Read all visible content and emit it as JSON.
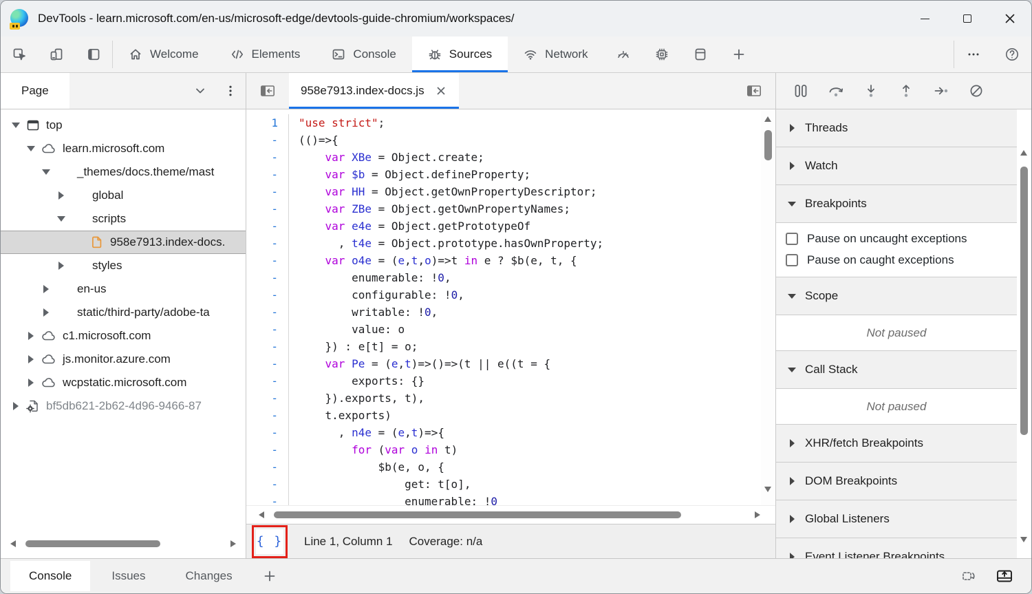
{
  "window": {
    "title": "DevTools - learn.microsoft.com/en-us/microsoft-edge/devtools-guide-chromium/workspaces/",
    "controls": [
      {
        "name": "minimize"
      },
      {
        "name": "maximize"
      },
      {
        "name": "close"
      }
    ]
  },
  "toolbar": {
    "tools": [
      {
        "icon": "inspect"
      },
      {
        "icon": "device-emulation"
      },
      {
        "icon": "focus-mode"
      }
    ],
    "tabs": [
      {
        "label": "Welcome",
        "icon": "home",
        "active": false
      },
      {
        "label": "Elements",
        "icon": "elements",
        "active": false
      },
      {
        "label": "Console",
        "icon": "console",
        "active": false
      },
      {
        "label": "Sources",
        "icon": "sources-bug",
        "active": true
      },
      {
        "label": "Network",
        "icon": "network",
        "active": false
      }
    ],
    "icon_tabs": [
      {
        "icon": "performance"
      },
      {
        "icon": "memory"
      },
      {
        "icon": "application"
      },
      {
        "icon": "add-tab"
      }
    ],
    "right_buttons": [
      {
        "icon": "more-options"
      },
      {
        "icon": "help"
      }
    ]
  },
  "sidebar": {
    "header": {
      "title": "Page",
      "icons": [
        "chevron-down",
        "kebab-menu"
      ]
    },
    "tree": [
      {
        "label": "top",
        "icon": "frame",
        "arrow": "down",
        "indent": 0
      },
      {
        "label": "learn.microsoft.com",
        "icon": "cloud",
        "arrow": "down",
        "indent": 1
      },
      {
        "label": "_themes/docs.theme/mast",
        "icon": "folder",
        "arrow": "down",
        "indent": 2
      },
      {
        "label": "global",
        "icon": "folder",
        "arrow": "right",
        "indent": 3
      },
      {
        "label": "scripts",
        "icon": "folder",
        "arrow": "down",
        "indent": 3
      },
      {
        "label": "958e7913.index-docs.",
        "icon": "file",
        "arrow": null,
        "indent": 4,
        "selected": true
      },
      {
        "label": "styles",
        "icon": "folder",
        "arrow": "right",
        "indent": 3
      },
      {
        "label": "en-us",
        "icon": "folder",
        "arrow": "right",
        "indent": 2
      },
      {
        "label": "static/third-party/adobe-ta",
        "icon": "folder",
        "arrow": "right",
        "indent": 2
      },
      {
        "label": "c1.microsoft.com",
        "icon": "cloud",
        "arrow": "right",
        "indent": 1
      },
      {
        "label": "js.monitor.azure.com",
        "icon": "cloud",
        "arrow": "right",
        "indent": 1
      },
      {
        "label": "wcpstatic.microsoft.com",
        "icon": "cloud",
        "arrow": "right",
        "indent": 1
      },
      {
        "label": "bf5db621-2b62-4d96-9466-87",
        "icon": "worker",
        "arrow": "right",
        "indent": 0,
        "muted": true
      }
    ]
  },
  "editor": {
    "tab": {
      "name": "958e7913.index-docs.js",
      "close_icon": "close"
    },
    "code_lines": [
      {
        "g": "1",
        "s": [
          [
            "\"use strict\"",
            "s"
          ],
          [
            ";",
            "d"
          ]
        ]
      },
      {
        "g": "-",
        "s": [
          [
            "(()=>{",
            "d"
          ]
        ]
      },
      {
        "g": "-",
        "s": [
          [
            "    ",
            "d"
          ],
          [
            "var",
            "k"
          ],
          [
            " ",
            "d"
          ],
          [
            "XBe",
            "v"
          ],
          [
            " = Object.create;",
            "d"
          ]
        ]
      },
      {
        "g": "-",
        "s": [
          [
            "    ",
            "d"
          ],
          [
            "var",
            "k"
          ],
          [
            " ",
            "d"
          ],
          [
            "$b",
            "v"
          ],
          [
            " = Object.defineProperty;",
            "d"
          ]
        ]
      },
      {
        "g": "-",
        "s": [
          [
            "    ",
            "d"
          ],
          [
            "var",
            "k"
          ],
          [
            " ",
            "d"
          ],
          [
            "HH",
            "v"
          ],
          [
            " = Object.getOwnPropertyDescriptor;",
            "d"
          ]
        ]
      },
      {
        "g": "-",
        "s": [
          [
            "    ",
            "d"
          ],
          [
            "var",
            "k"
          ],
          [
            " ",
            "d"
          ],
          [
            "ZBe",
            "v"
          ],
          [
            " = Object.getOwnPropertyNames;",
            "d"
          ]
        ]
      },
      {
        "g": "-",
        "s": [
          [
            "    ",
            "d"
          ],
          [
            "var",
            "k"
          ],
          [
            " ",
            "d"
          ],
          [
            "e4e",
            "v"
          ],
          [
            " = Object.getPrototypeOf",
            "d"
          ]
        ]
      },
      {
        "g": "-",
        "s": [
          [
            "      , ",
            "d"
          ],
          [
            "t4e",
            "v"
          ],
          [
            " = Object.prototype.hasOwnProperty;",
            "d"
          ]
        ]
      },
      {
        "g": "-",
        "s": [
          [
            "    ",
            "d"
          ],
          [
            "var",
            "k"
          ],
          [
            " ",
            "d"
          ],
          [
            "o4e",
            "v"
          ],
          [
            " = (",
            "d"
          ],
          [
            "e",
            "v"
          ],
          [
            ",",
            "d"
          ],
          [
            "t",
            "v"
          ],
          [
            ",",
            "d"
          ],
          [
            "o",
            "v"
          ],
          [
            ")=>t ",
            "d"
          ],
          [
            "in",
            "k"
          ],
          [
            " e ? $b(e, t, {",
            "d"
          ]
        ]
      },
      {
        "g": "-",
        "s": [
          [
            "        enumerable: !",
            "d"
          ],
          [
            "0",
            "n"
          ],
          [
            ",",
            "d"
          ]
        ]
      },
      {
        "g": "-",
        "s": [
          [
            "        configurable: !",
            "d"
          ],
          [
            "0",
            "n"
          ],
          [
            ",",
            "d"
          ]
        ]
      },
      {
        "g": "-",
        "s": [
          [
            "        writable: !",
            "d"
          ],
          [
            "0",
            "n"
          ],
          [
            ",",
            "d"
          ]
        ]
      },
      {
        "g": "-",
        "s": [
          [
            "        value: o",
            "d"
          ]
        ]
      },
      {
        "g": "-",
        "s": [
          [
            "    }) : e[t] = o;",
            "d"
          ]
        ]
      },
      {
        "g": "-",
        "s": [
          [
            "    ",
            "d"
          ],
          [
            "var",
            "k"
          ],
          [
            " ",
            "d"
          ],
          [
            "Pe",
            "v"
          ],
          [
            " = (",
            "d"
          ],
          [
            "e",
            "v"
          ],
          [
            ",",
            "d"
          ],
          [
            "t",
            "v"
          ],
          [
            ")=>()=>(t || e((t = {",
            "d"
          ]
        ]
      },
      {
        "g": "-",
        "s": [
          [
            "        exports: {}",
            "d"
          ]
        ]
      },
      {
        "g": "-",
        "s": [
          [
            "    }).exports, t),",
            "d"
          ]
        ]
      },
      {
        "g": "-",
        "s": [
          [
            "    t.exports)",
            "d"
          ]
        ]
      },
      {
        "g": "-",
        "s": [
          [
            "      , ",
            "d"
          ],
          [
            "n4e",
            "v"
          ],
          [
            " = (",
            "d"
          ],
          [
            "e",
            "v"
          ],
          [
            ",",
            "d"
          ],
          [
            "t",
            "v"
          ],
          [
            ")=>{",
            "d"
          ]
        ]
      },
      {
        "g": "-",
        "s": [
          [
            "        ",
            "d"
          ],
          [
            "for",
            "k"
          ],
          [
            " (",
            "d"
          ],
          [
            "var",
            "k"
          ],
          [
            " ",
            "d"
          ],
          [
            "o",
            "v"
          ],
          [
            " ",
            "d"
          ],
          [
            "in",
            "k"
          ],
          [
            " t)",
            "d"
          ]
        ]
      },
      {
        "g": "-",
        "s": [
          [
            "            $b(e, o, {",
            "d"
          ]
        ]
      },
      {
        "g": "-",
        "s": [
          [
            "                get: t[o],",
            "d"
          ]
        ]
      },
      {
        "g": "-",
        "s": [
          [
            "                enumerable: !",
            "d"
          ],
          [
            "0",
            "n"
          ]
        ]
      }
    ],
    "status": {
      "pretty_print": "{ }",
      "position": "Line 1, Column 1",
      "coverage": "Coverage: n/a"
    }
  },
  "debugger": {
    "toolbar": [
      {
        "icon": "pause"
      },
      {
        "icon": "step-over"
      },
      {
        "icon": "step-into"
      },
      {
        "icon": "step-out"
      },
      {
        "icon": "step"
      },
      {
        "icon": "deactivate-breakpoints"
      }
    ],
    "sections": [
      {
        "title": "Threads",
        "arrow": "right"
      },
      {
        "title": "Watch",
        "arrow": "right"
      },
      {
        "title": "Breakpoints",
        "arrow": "down",
        "checkboxes": [
          {
            "label": "Pause on uncaught exceptions",
            "checked": false
          },
          {
            "label": "Pause on caught exceptions",
            "checked": false
          }
        ]
      },
      {
        "title": "Scope",
        "arrow": "down",
        "note": "Not paused"
      },
      {
        "title": "Call Stack",
        "arrow": "down",
        "note": "Not paused"
      },
      {
        "title": "XHR/fetch Breakpoints",
        "arrow": "right"
      },
      {
        "title": "DOM Breakpoints",
        "arrow": "right"
      },
      {
        "title": "Global Listeners",
        "arrow": "right"
      },
      {
        "title": "Event Listener Breakpoints",
        "arrow": "right"
      }
    ]
  },
  "drawer": {
    "tabs": [
      {
        "label": "Console",
        "active": true
      },
      {
        "label": "Issues",
        "active": false
      },
      {
        "label": "Changes",
        "active": false
      }
    ],
    "add_icon": "add-tab",
    "right_buttons": [
      {
        "icon": "restore-defaults"
      },
      {
        "icon": "expand-panel"
      }
    ]
  },
  "colors": {
    "accent": "#1a73e8",
    "annotation": "#e32119",
    "keyword": "#af00db",
    "variable": "#2a2fd0",
    "string": "#c41a16",
    "number": "#1a1aa6",
    "folder": "#2f7be8",
    "file": "#e8973a"
  }
}
